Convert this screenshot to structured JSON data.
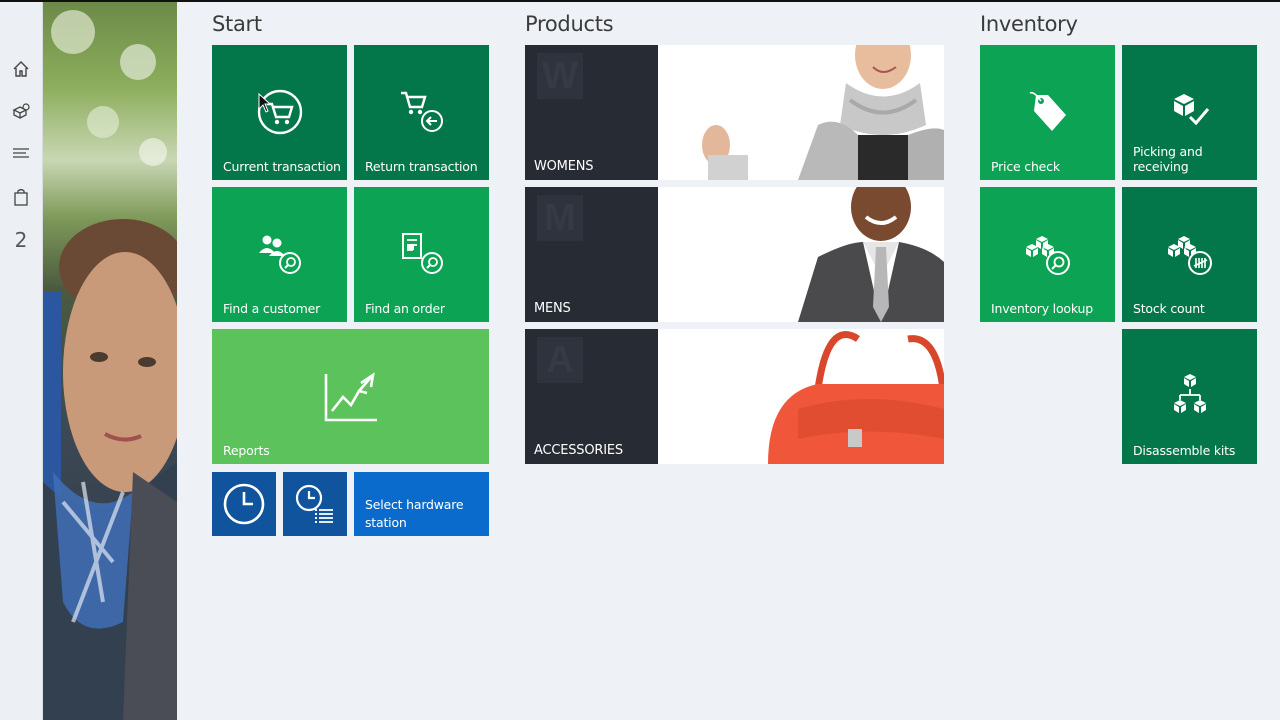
{
  "nav": {
    "count": "2"
  },
  "sections": {
    "start": "Start",
    "products": "Products",
    "inventory": "Inventory"
  },
  "start_tiles": {
    "current_transaction": "Current transaction",
    "return_transaction": "Return transaction",
    "find_customer": "Find a customer",
    "find_order": "Find an order",
    "reports": "Reports",
    "select_hardware_station": "Select hardware station"
  },
  "products": [
    {
      "letter": "W",
      "label": "WOMENS"
    },
    {
      "letter": "M",
      "label": "MENS"
    },
    {
      "letter": "A",
      "label": "ACCESSORIES"
    }
  ],
  "inventory_tiles": {
    "price_check": "Price check",
    "picking_receiving": "Picking and receiving",
    "inventory_lookup": "Inventory lookup",
    "stock_count": "Stock count",
    "disassemble_kits": "Disassemble kits"
  },
  "colors": {
    "tile_dark_green": "#04774a",
    "tile_green": "#0ca355",
    "tile_light_green": "#5cc35c",
    "tile_navy": "#10549d",
    "tile_blue": "#0b6bcc",
    "product_dark": "#272b34",
    "background": "#eef2f6"
  }
}
